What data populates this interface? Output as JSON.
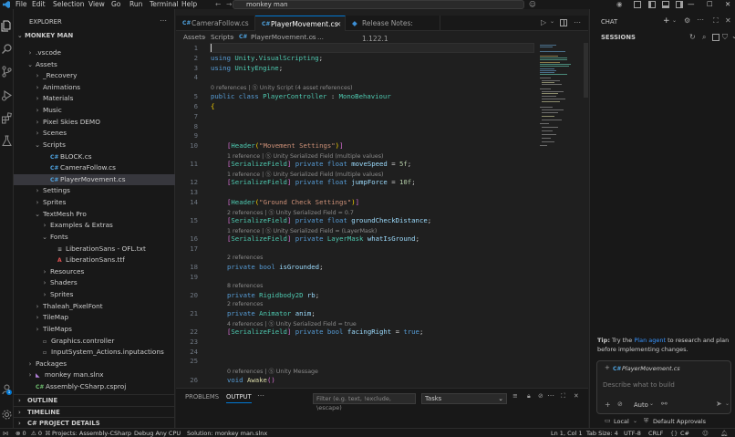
{
  "titlebar": {
    "menu": [
      "File",
      "Edit",
      "Selection",
      "View",
      "Go",
      "Run",
      "Terminal",
      "Help"
    ],
    "search_text": "monkey man"
  },
  "sidebar": {
    "title": "EXPLORER",
    "root": "MONKEY MAN",
    "items": [
      {
        "label": ".vscode",
        "type": "folder",
        "depth": 1,
        "open": false
      },
      {
        "label": "Assets",
        "type": "folder",
        "depth": 1,
        "open": true
      },
      {
        "label": "_Recovery",
        "type": "folder",
        "depth": 2,
        "open": false
      },
      {
        "label": "Animations",
        "type": "folder",
        "depth": 2,
        "open": false
      },
      {
        "label": "Materials",
        "type": "folder",
        "depth": 2,
        "open": false
      },
      {
        "label": "Music",
        "type": "folder",
        "depth": 2,
        "open": false
      },
      {
        "label": "Pixel Skies DEMO",
        "type": "folder",
        "depth": 2,
        "open": false
      },
      {
        "label": "Scenes",
        "type": "folder",
        "depth": 2,
        "open": false
      },
      {
        "label": "Scripts",
        "type": "folder",
        "depth": 2,
        "open": true
      },
      {
        "label": "BLOCK.cs",
        "type": "cs",
        "depth": 3
      },
      {
        "label": "CameraFollow.cs",
        "type": "cs",
        "depth": 3
      },
      {
        "label": "PlayerMovement.cs",
        "type": "cs",
        "depth": 3,
        "selected": true
      },
      {
        "label": "Settings",
        "type": "folder",
        "depth": 2,
        "open": false
      },
      {
        "label": "Sprites",
        "type": "folder",
        "depth": 2,
        "open": false
      },
      {
        "label": "TextMesh Pro",
        "type": "folder",
        "depth": 2,
        "open": true
      },
      {
        "label": "Examples & Extras",
        "type": "folder",
        "depth": 3,
        "open": false
      },
      {
        "label": "Fonts",
        "type": "folder",
        "depth": 3,
        "open": true
      },
      {
        "label": "LiberationSans - OFL.txt",
        "type": "txt",
        "depth": 4
      },
      {
        "label": "LiberationSans.ttf",
        "type": "ttf",
        "depth": 4
      },
      {
        "label": "Resources",
        "type": "folder",
        "depth": 3,
        "open": false
      },
      {
        "label": "Shaders",
        "type": "folder",
        "depth": 3,
        "open": false
      },
      {
        "label": "Sprites",
        "type": "folder",
        "depth": 3,
        "open": false
      },
      {
        "label": "Thaleah_PixelFont",
        "type": "folder",
        "depth": 2,
        "open": false
      },
      {
        "label": "TileMap",
        "type": "folder",
        "depth": 2,
        "open": false
      },
      {
        "label": "TileMaps",
        "type": "folder",
        "depth": 2,
        "open": false
      },
      {
        "label": "Graphics.controller",
        "type": "file",
        "depth": 2
      },
      {
        "label": "InputSystem_Actions.inputactions",
        "type": "file",
        "depth": 2
      },
      {
        "label": "Packages",
        "type": "folder",
        "depth": 1,
        "open": false
      },
      {
        "label": "monkey man.slnx",
        "type": "sln",
        "depth": 1,
        "open": false
      },
      {
        "label": "Assembly-CSharp.csproj",
        "type": "csproj",
        "depth": 1
      }
    ],
    "sections": [
      "OUTLINE",
      "TIMELINE",
      "C# PROJECT DETAILS"
    ]
  },
  "tabs": [
    {
      "label": "CameraFollow.cs",
      "active": false
    },
    {
      "label": "PlayerMovement.cs",
      "active": true
    },
    {
      "label": "Release Notes: 1.122.1",
      "active": false
    }
  ],
  "breadcrumb": [
    "Assets",
    "Scripts",
    "PlayerMovement.cs",
    "..."
  ],
  "code": {
    "lens": {
      "l5": "0 references | Ⓢ Unity Script (4 asset references)",
      "l11": "1 reference | Ⓢ Unity Serialized Field (multiple values)",
      "l12": "1 reference | Ⓢ Unity Serialized Field (multiple values)",
      "l15": "2 references | Ⓢ Unity Serialized Field = 0.7",
      "l16": "1 reference | Ⓢ Unity Serialized Field = (LayerMask)",
      "l18": "2 references",
      "l20": "8 references",
      "l21": "2 references",
      "l22": "4 references | Ⓢ Unity Serialized Field = true",
      "l26": "0 references | Ⓢ Unity Message"
    }
  },
  "panel": {
    "tabs": [
      "PROBLEMS",
      "OUTPUT"
    ],
    "active_tab": "OUTPUT",
    "filter_placeholder": "Filter (e.g. text, !exclude, \\escape)",
    "tasks_value": "Tasks"
  },
  "chat": {
    "title": "CHAT",
    "sessions": "SESSIONS",
    "tip_label": "Tip:",
    "tip_text_1": "Try the",
    "tip_link": "Plan agent",
    "tip_text_2": "to research and plan before implementing changes.",
    "context_file": "PlayerMovement.cs",
    "input_placeholder": "Describe what to build",
    "mode": "Auto",
    "local_label": "Local",
    "approvals_label": "Default Approvals"
  },
  "statusbar": {
    "errors": "0",
    "warnings": "0",
    "project": "Projects: Assembly-CSharp",
    "config": "Debug Any CPU",
    "solution": "Solution: monkey man.slnx",
    "position": "Ln 1, Col 1",
    "tab_size": "Tab Size: 4",
    "encoding": "UTF-8",
    "eol": "CRLF",
    "language": "C#"
  }
}
